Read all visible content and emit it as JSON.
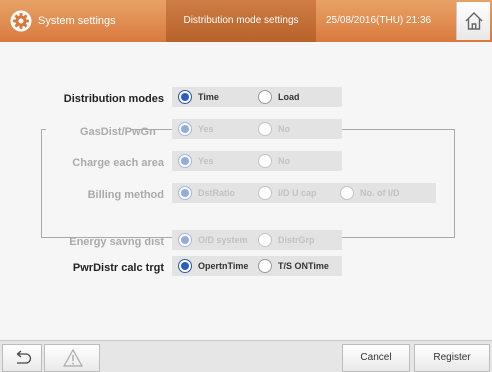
{
  "header": {
    "title": "System settings",
    "subtitle": "Distribution mode settings",
    "datetime": "25/08/2016(THU) 21:36",
    "accent_color": "#d9793e"
  },
  "rows": [
    {
      "label": "Distribution modes",
      "enabled": true,
      "options": [
        {
          "label": "Time",
          "selected": true
        },
        {
          "label": "Load",
          "selected": false
        }
      ]
    },
    {
      "label": "GasDist/PwGn",
      "enabled": false,
      "options": [
        {
          "label": "Yes",
          "selected": true
        },
        {
          "label": "No",
          "selected": false
        }
      ]
    },
    {
      "label": "Charge each area",
      "enabled": false,
      "options": [
        {
          "label": "Yes",
          "selected": true
        },
        {
          "label": "No",
          "selected": false
        }
      ]
    },
    {
      "label": "Billing method",
      "enabled": false,
      "options": [
        {
          "label": "DstRatio",
          "selected": true
        },
        {
          "label": "I/D U cap",
          "selected": false
        },
        {
          "label": "No. of I/D",
          "selected": false
        }
      ]
    },
    {
      "label": "Energy savng dist",
      "enabled": false,
      "options": [
        {
          "label": "O/D system",
          "selected": true
        },
        {
          "label": "DistrGrp",
          "selected": false
        }
      ]
    },
    {
      "label": "PwrDistr calc trgt",
      "enabled": true,
      "options": [
        {
          "label": "OpertnTime",
          "selected": true
        },
        {
          "label": "T/S ONTime",
          "selected": false
        }
      ]
    }
  ],
  "footer": {
    "cancel_label": "Cancel",
    "register_label": "Register"
  },
  "icons": [
    "gear-icon",
    "home-icon",
    "back-icon",
    "warning-icon"
  ]
}
